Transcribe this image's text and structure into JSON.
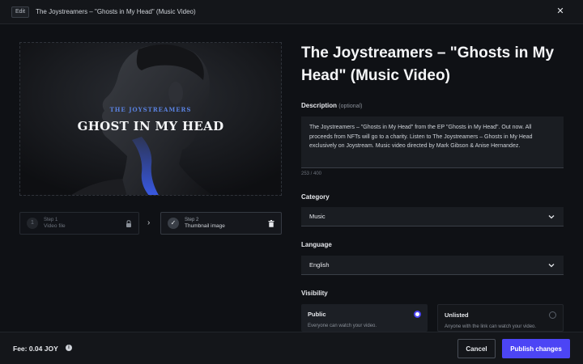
{
  "window": {
    "edit_badge": "Edit",
    "title": "The Joystreamers – \"Ghosts in My Head\" (Music Video)",
    "close_icon": "close-icon"
  },
  "preview": {
    "brand": "THE JOYSTREAMERS",
    "title": "GHOST IN MY HEAD"
  },
  "steps": [
    {
      "number": "1",
      "small": "Step 1",
      "label": "Video file",
      "icon": "lock-icon"
    },
    {
      "small": "Step 2",
      "label": "Thumbnail image",
      "icon": "trash-icon"
    }
  ],
  "form": {
    "title": "The Joystreamers – \"Ghosts in My Head\" (Music Video)",
    "description_label": "Description",
    "description_optional": "(optional)",
    "description_value": "The Joystreamers – \"Ghosts in My Head\" from the EP \"Ghosts in My Head\". Out now. All proceeds from NFTs will go to a charity. Listen to The Joystreamers – Ghosts in My Head exclusively on Joystream. Music video directed by Mark Gibson & Anise Hernandez.",
    "char_count": "253 / 400",
    "category_label": "Category",
    "category_value": "Music",
    "language_label": "Language",
    "language_value": "English",
    "visibility_label": "Visibility",
    "visibility_options": [
      {
        "title": "Public",
        "desc": "Everyone can watch your video.",
        "selected": true
      },
      {
        "title": "Unlisted",
        "desc": "Anyone with the link can watch your video.",
        "selected": false
      }
    ]
  },
  "footer": {
    "fee": "Fee: 0.04 JOY",
    "cancel": "Cancel",
    "publish": "Publish changes"
  },
  "colors": {
    "accent": "#4c45f5",
    "brand_text": "#5a82e0"
  }
}
